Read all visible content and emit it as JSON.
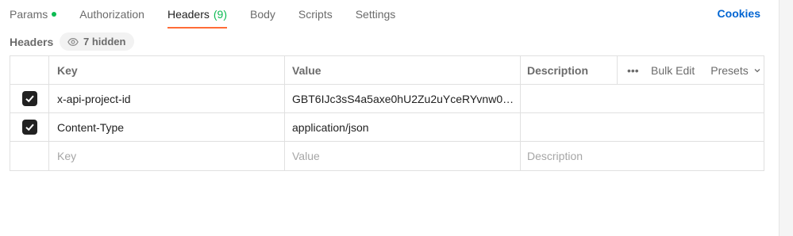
{
  "tabs": [
    {
      "label": "Params",
      "indicator": "green-dot"
    },
    {
      "label": "Authorization"
    },
    {
      "label": "Headers",
      "count": "(9)",
      "active": true
    },
    {
      "label": "Body"
    },
    {
      "label": "Scripts"
    },
    {
      "label": "Settings"
    }
  ],
  "cookies_label": "Cookies",
  "section": {
    "title": "Headers",
    "hidden_label": "7 hidden"
  },
  "table": {
    "columns": {
      "key": "Key",
      "value": "Value",
      "description": "Description"
    },
    "actions": {
      "more_icon": "more-horizontal-icon",
      "bulk_edit": "Bulk Edit",
      "presets": "Presets"
    },
    "rows": [
      {
        "checked": true,
        "key": "x-api-project-id",
        "value": "GBT6IJc3sS4a5axe0hU2Zu2uYceRYvnw06…",
        "description": ""
      },
      {
        "checked": true,
        "key": "Content-Type",
        "value": "application/json",
        "description": ""
      }
    ],
    "new_row": {
      "key_placeholder": "Key",
      "value_placeholder": "Value",
      "description_placeholder": "Description"
    }
  },
  "colors": {
    "accent": "#ff6c37",
    "success": "#0cbb52",
    "link": "#0265d2"
  }
}
